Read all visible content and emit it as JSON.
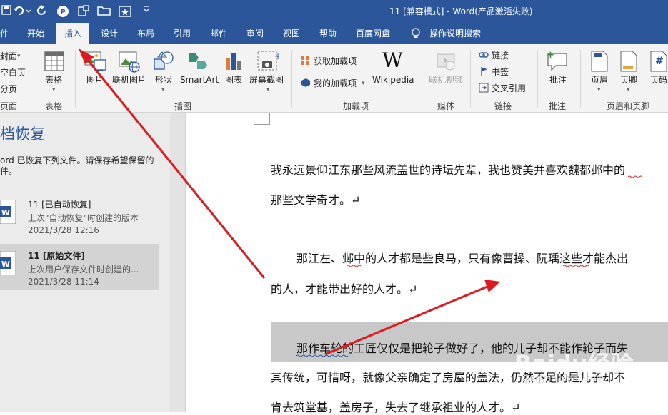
{
  "window": {
    "title": "11 [兼容模式]  -  Word(产品激活失败)",
    "quick_access": [
      "undo-icon",
      "redo-icon",
      "p-icon",
      "format-painter-icon",
      "open-folder-icon",
      "star-icon",
      "more-icon"
    ]
  },
  "tabs": [
    {
      "label": "件"
    },
    {
      "label": "开始"
    },
    {
      "label": "插入",
      "active": true
    },
    {
      "label": "设计"
    },
    {
      "label": "布局"
    },
    {
      "label": "引用"
    },
    {
      "label": "邮件"
    },
    {
      "label": "审阅"
    },
    {
      "label": "视图"
    },
    {
      "label": "帮助"
    },
    {
      "label": "百度网盘"
    },
    {
      "label": "操作说明搜索"
    }
  ],
  "ribbon": {
    "pages": {
      "cover": "封面",
      "blank": "空白页",
      "break": "分页",
      "group": "页面"
    },
    "table": {
      "label": "表格",
      "group": "表格"
    },
    "illustrations": {
      "picture": "图片",
      "online_picture": "联机图片",
      "shapes": "形状",
      "smartart": "SmartArt",
      "chart": "图表",
      "screenshot": "屏幕截图",
      "group": "插图"
    },
    "addins": {
      "get": "获取加载项",
      "my": "我的加载项",
      "wikipedia": "Wikipedia",
      "wiki_letter": "W",
      "group": "加载项"
    },
    "media": {
      "online_video": "联机视频",
      "group": "媒体"
    },
    "links": {
      "link": "链接",
      "bookmark": "书签",
      "crossref": "交叉引用",
      "group": "链接"
    },
    "comments": {
      "comment": "批注",
      "group": "批注"
    },
    "header_footer": {
      "header": "页眉",
      "footer": "页脚",
      "page_number": "页码",
      "pn_symbol": "#",
      "group": "页眉和页脚"
    }
  },
  "recovery_pane": {
    "title": "档恢复",
    "desc_line1": "ord 已恢复下列文件。请保存希望保留的",
    "desc_line2": "件。",
    "files": [
      {
        "name": "11  [已自动恢复]",
        "sub": "上次\"自动恢复\"时创建的版本",
        "date": "2021/3/28 12:16",
        "selected": false
      },
      {
        "name": "11  [原始文件]",
        "sub": "上次用户保存文件时创建的...",
        "date": "2021/3/28 11:14",
        "selected": true
      }
    ]
  },
  "document": {
    "lines": [
      "我永远景仰江东那些风流盖世的诗坛先辈，我也赞美并喜欢魏都邺中的",
      "那些文学奇才。↵",
      "那江左、邺中的人才都是些良马，只有像曹操、阮瑀这些才能杰出",
      "的人，才能带出好的人才。↵",
      "那作车轮的工匠仅仅是把轮子做好了，他的儿子却不能作轮子而失",
      "其传统，可惜呀，就像父亲确定了房屋的盖法，仍然不足的是儿子却不",
      "肯去筑堂基，盖房子，失去了继承祖业的人才。↵"
    ]
  },
  "watermark": {
    "text": "Baidu经验",
    "sub": "jingyan.baidu.com"
  },
  "colors": {
    "brand": "#2b579a",
    "ribbon_bg": "#f3f3f3",
    "arrow": "#e0191d",
    "highlight": "#c8c8c8"
  }
}
